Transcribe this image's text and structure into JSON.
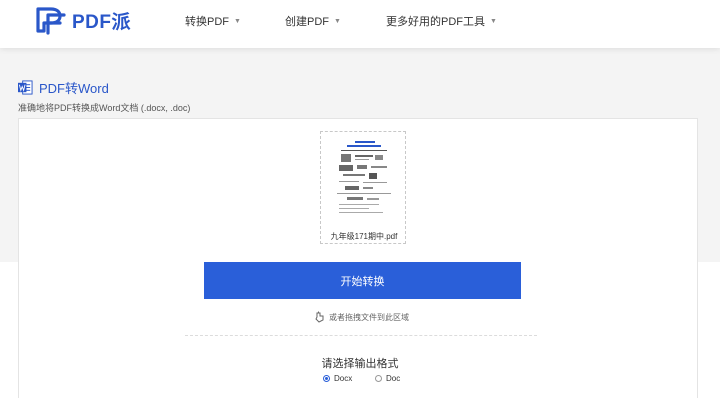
{
  "brand": {
    "name": "PDF派",
    "color": "#2a57c9"
  },
  "nav": [
    {
      "label": "转换PDF"
    },
    {
      "label": "创建PDF"
    },
    {
      "label": "更多好用的PDF工具"
    }
  ],
  "page": {
    "title": "PDF转Word",
    "subtitle": "准确地将PDF转换成Word文档 (.docx, .doc)"
  },
  "file": {
    "name": "九年级171期中.pdf"
  },
  "actions": {
    "convert_label": "开始转换",
    "drag_hint": "或者拖拽文件到此区域",
    "accent": "#2a5fd9"
  },
  "format": {
    "label": "请选择输出格式",
    "options": [
      {
        "label": "Docx",
        "selected": true
      },
      {
        "label": "Doc",
        "selected": false
      }
    ]
  }
}
